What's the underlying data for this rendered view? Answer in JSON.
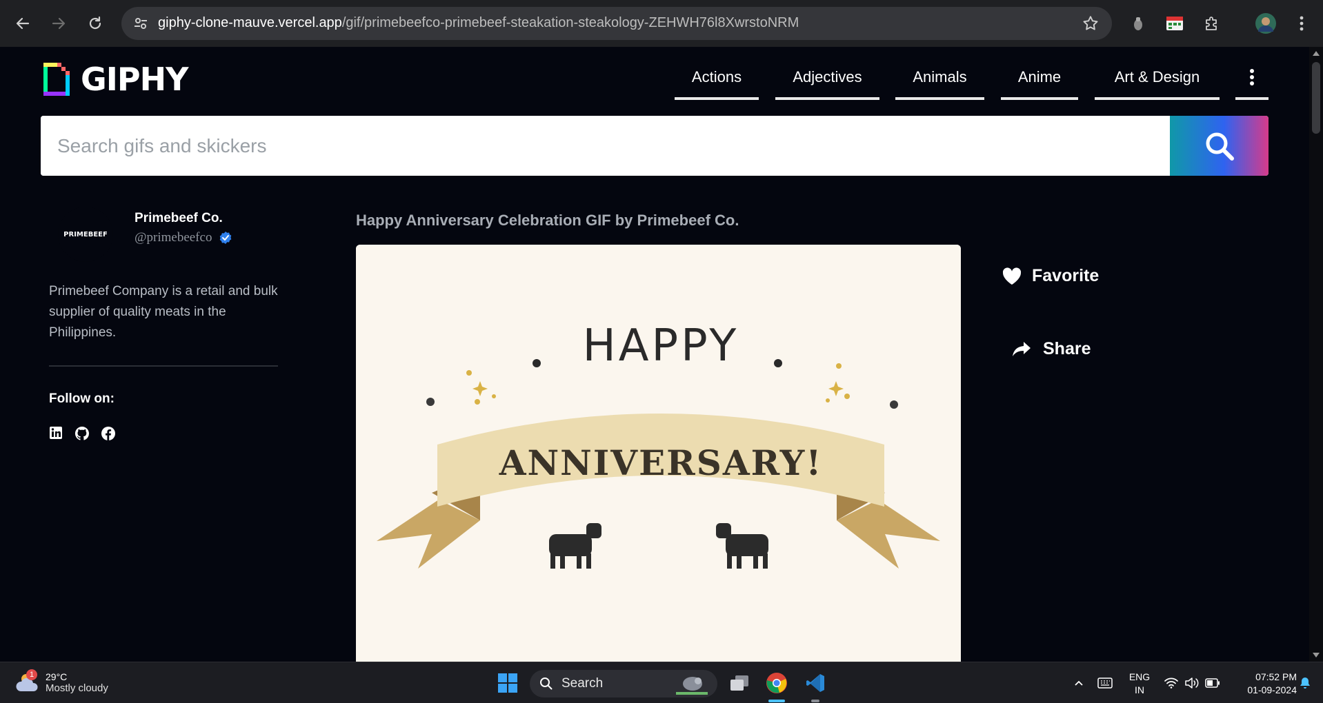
{
  "browser": {
    "url_host": "giphy-clone-mauve.vercel.app",
    "url_path": "/gif/primebeefco-primebeef-steakation-steakology-ZEHWH76l8XwrstoNRM"
  },
  "header": {
    "logo_text": "GIPHY",
    "categories": [
      {
        "label": "Actions"
      },
      {
        "label": "Adjectives"
      },
      {
        "label": "Animals"
      },
      {
        "label": "Anime"
      },
      {
        "label": "Art & Design"
      }
    ]
  },
  "search": {
    "placeholder": "Search gifs and skickers"
  },
  "profile": {
    "avatar_text": "PRIMEBEEF",
    "name": "Primebeef Co.",
    "handle": "@primebeefco",
    "bio": "Primebeef Company is a retail and bulk supplier of quality meats in the Philippines.",
    "follow_label": "Follow on:"
  },
  "gif": {
    "title": "Happy Anniversary Celebration GIF by Primebeef Co.",
    "text_top": "HAPPY",
    "text_banner": "ANNIVERSARY!"
  },
  "actions": {
    "favorite": "Favorite",
    "share": "Share"
  },
  "taskbar": {
    "weather_temp": "29°C",
    "weather_desc": "Mostly cloudy",
    "weather_badge": "1",
    "search_label": "Search",
    "lang_line1": "ENG",
    "lang_line2": "IN",
    "time": "07:52 PM",
    "date": "01-09-2024"
  },
  "colors": {
    "page_bg": "#04060f",
    "search_gradient": [
      "#1098a8",
      "#2f63f0",
      "#d63b8a"
    ],
    "verified_blue": "#2f80ed"
  }
}
